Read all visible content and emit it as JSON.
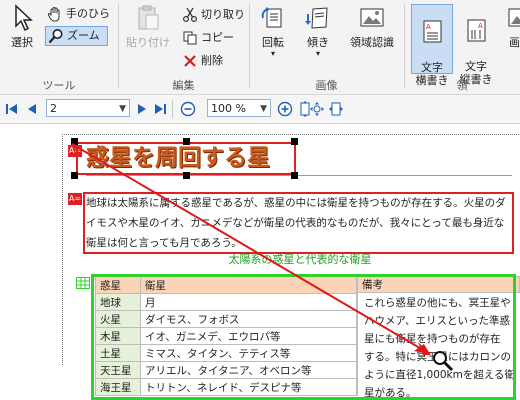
{
  "ribbon": {
    "tool_group": {
      "label": "ツール",
      "select_label": "選択",
      "hand_label": "手のひら",
      "zoom_label": "ズーム"
    },
    "edit_group": {
      "label": "編集",
      "paste_label": "貼り付け",
      "cut_label": "切り取り",
      "copy_label": "コピー",
      "delete_label": "削除"
    },
    "image_group": {
      "label": "画像",
      "rotate_label": "回転",
      "skew_label": "傾き",
      "region_label": "領域認識"
    },
    "text_group": {
      "label": "領",
      "horizontal_label": "文字\n横書き",
      "vertical_label": "文字\n縦書き",
      "image_label": "画像"
    }
  },
  "nav": {
    "page_value": "2",
    "zoom_value": "100 %"
  },
  "document": {
    "title": "惑星を周回する星",
    "title_marker": "A=",
    "body_marker": "A=",
    "paragraph_lines": [
      "地球は太陽系に属する惑星であるが、惑星の中には衛星を持つものが存在する。火星のダ",
      "イモスや木星のイオ、ガニメデなどが衛星の代表的なものだが、我々にとって最も身近な",
      "衛星は何と言っても月であろう。"
    ],
    "table_caption": "太陽系の惑星と代表的な衛星",
    "table": {
      "headers": [
        "惑星",
        "衛星",
        "備考"
      ],
      "rows": [
        [
          "地球",
          "月"
        ],
        [
          "火星",
          "ダイモス、フォボス"
        ],
        [
          "木星",
          "イオ、ガニメデ、エウロパ等"
        ],
        [
          "土星",
          "ミマス、タイタン、テティス等"
        ],
        [
          "天王星",
          "アリエル、タイタニア、オベロン等"
        ],
        [
          "海王星",
          "トリトン、ネレイド、デスピナ等"
        ]
      ],
      "remarks": "これら惑星の他にも、冥王星や\nハウメア、エリスといった準惑\n星にも衛星を持つものが存在\nする。特に冥王星にはカロンの\nように直径1,000kmを超える衛\n星がある。"
    }
  },
  "colors": {
    "title_text": "#c85a1c",
    "frame_red": "#e02020",
    "frame_green": "#2fd12f",
    "caption_green": "#1fa01f",
    "arrow_red": "#e01818"
  }
}
